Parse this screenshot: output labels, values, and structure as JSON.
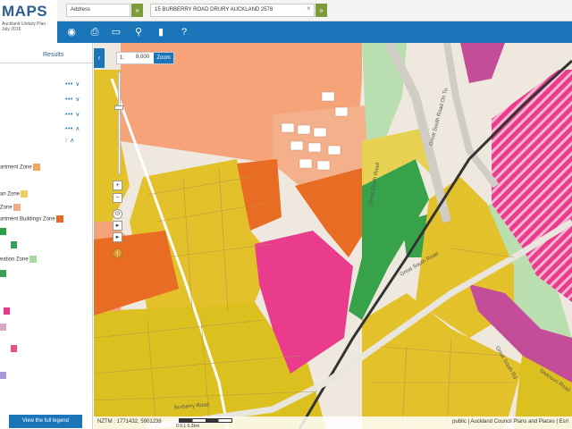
{
  "app": {
    "logo_title": "MAPS",
    "logo_subtitle": "Auckland Unitary Plan · July 2016"
  },
  "search": {
    "type_value": "Address",
    "query_value": "15 BURBERRY ROAD DRURY AUCKLAND 2578",
    "go_glyph": "»",
    "clear_glyph": "×"
  },
  "toolbar": {
    "icons": [
      "eye-icon",
      "print-icon",
      "measure-icon",
      "location-pin-icon",
      "bookmark-icon",
      "help-icon"
    ],
    "glyphs": [
      "◉",
      "⎙",
      "▭",
      "⚲",
      "▮",
      "?"
    ]
  },
  "panel": {
    "tab_results": "Results",
    "layer_controls": [
      "••• ∨",
      "••• ∨",
      "••• ∨",
      "••• ∧",
      "⁝ ∧"
    ],
    "legend": [
      {
        "label": "artment Zone",
        "color": "#f0a660"
      },
      {
        "label": "an Zone",
        "color": "#f0d060"
      },
      {
        "label": "Zone",
        "color": "#f5a97e"
      },
      {
        "label": "artment Buildings Zone",
        "color": "#e86a2a"
      },
      {
        "label": "",
        "color": "#2e9e48"
      },
      {
        "label": "",
        "color": "#3aa058"
      },
      {
        "label": "eation Zone",
        "color": "#a6d8a0"
      },
      {
        "label": "",
        "color": "#3aa058"
      },
      {
        "label": "",
        "color": "#e83a8c"
      },
      {
        "label": "",
        "color": "#d8a8c8"
      },
      {
        "label": "",
        "color": "#e8508c"
      },
      {
        "label": "",
        "color": "#a898d8"
      }
    ],
    "legend_button": "View the full legend"
  },
  "map": {
    "scale_label": "1:",
    "scale_value": "8,000",
    "zoom_button": "Zoom",
    "controls": [
      "+",
      "−",
      "⊙",
      "▸",
      "▸",
      "i"
    ],
    "coord_readout": "NZTM : 1771432, 5901238",
    "scalebar_labels": "0      0.1      0.2km",
    "attribution": "public | Auckland Council Plans and Places | Esri",
    "road_labels": [
      "Great South Road",
      "Great South Road",
      "Great South Road",
      "Great South Road On Tu",
      "Burberry Road",
      "Great South Rd",
      "Swanson Road"
    ]
  },
  "colors": {
    "accent": "#1b76b9",
    "go": "#7c9b3a",
    "rural_production": "#e3c12a",
    "mixed_rural": "#e6d250",
    "terrace": "#f6a37a",
    "apartment": "#e86c24",
    "business": "#ea3c8c",
    "open_space": "#37a24a",
    "conservation": "#b9dfb0",
    "heavy_industry": "#c44d9a"
  }
}
